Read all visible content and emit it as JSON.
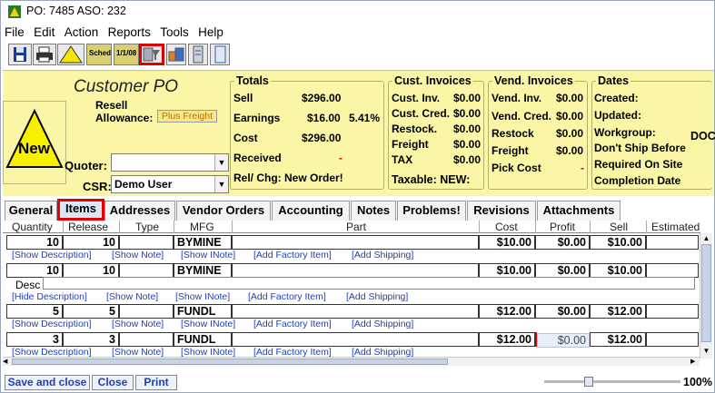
{
  "titlebar": {
    "title": "PO: 7485   ASO: 232"
  },
  "menu": [
    "File",
    "Edit",
    "Action",
    "Reports",
    "Tools",
    "Help"
  ],
  "toolbar": {
    "sched_label": "Sched",
    "date_label": "1/1/08"
  },
  "po": {
    "title": "Customer PO",
    "resell_label": "Resell",
    "allowance_label": "Allowance:",
    "plus_freight": "Plus Freight",
    "new_badge": "New",
    "quoter_label": "Quoter:",
    "quoter_value": "",
    "csr_label": "CSR:",
    "csr_value": "Demo User"
  },
  "totals": {
    "title": "Totals",
    "sell_label": "Sell",
    "sell": "$296.00",
    "earnings_label": "Earnings",
    "earnings": "$16.00",
    "earnings_pct": "5.41%",
    "cost_label": "Cost",
    "cost": "$296.00",
    "received_label": "Received",
    "received": "-",
    "relchg": "Rel/ Chg: New Order!"
  },
  "cust_invoices": {
    "title": "Cust. Invoices",
    "rows": [
      {
        "label": "Cust. Inv.",
        "value": "$0.00"
      },
      {
        "label": "Cust. Cred.",
        "value": "$0.00"
      },
      {
        "label": "Restock.",
        "value": "$0.00"
      },
      {
        "label": "Freight",
        "value": "$0.00"
      },
      {
        "label": "TAX",
        "value": "$0.00"
      }
    ],
    "taxable": "Taxable: NEW:"
  },
  "vend_invoices": {
    "title": "Vend. Invoices",
    "rows": [
      {
        "label": "Vend. Inv.",
        "value": "$0.00"
      },
      {
        "label": "Vend. Cred.",
        "value": "$0.00"
      },
      {
        "label": "Restock",
        "value": "$0.00"
      },
      {
        "label": "Freight",
        "value": "$0.00"
      }
    ],
    "pick_cost_label": "Pick Cost",
    "pick_cost": "-"
  },
  "dates": {
    "title": "Dates",
    "rows": [
      "Created:",
      "Updated:",
      "Workgroup:",
      "Don't Ship Before",
      "Required On Site",
      "Completion Date"
    ],
    "workgroup_value": "DOC"
  },
  "tabs": [
    "General",
    "Items",
    "Addresses",
    "Vendor Orders",
    "Accounting",
    "Notes",
    "Problems!",
    "Revisions",
    "Attachments"
  ],
  "grid": {
    "columns": [
      "Quantity",
      "Release",
      "Type",
      "MFG",
      "Part",
      "Cost",
      "Profit",
      "Sell",
      "Estimated"
    ],
    "rows": [
      {
        "qty": "10",
        "release": "10",
        "type": "",
        "mfg": "BYMINE",
        "part": "",
        "cost": "$10.00",
        "profit": "$0.00",
        "sell": "$10.00",
        "links": [
          "[Show Description]",
          "[Show Note]",
          "[Show INote]",
          "[Add Factory Item]",
          "[Add Shipping]"
        ]
      },
      {
        "qty": "10",
        "release": "10",
        "type": "",
        "mfg": "BYMINE",
        "part": "",
        "cost": "$10.00",
        "profit": "$0.00",
        "sell": "$10.00",
        "desc_label": "Desc",
        "links": [
          "[Hide Description]",
          "[Show Note]",
          "[Show INote]",
          "[Add Factory Item]",
          "[Add Shipping]"
        ]
      },
      {
        "qty": "5",
        "release": "5",
        "type": "",
        "mfg": "FUNDL",
        "part": "",
        "cost": "$12.00",
        "profit": "$0.00",
        "sell": "$12.00",
        "links": [
          "[Show Description]",
          "[Show Note]",
          "[Show INote]",
          "[Add Factory Item]",
          "[Add Shipping]"
        ]
      },
      {
        "qty": "3",
        "release": "3",
        "type": "",
        "mfg": "FUNDL",
        "part": "",
        "cost": "$12.00",
        "profit": "$0.00",
        "sell": "$12.00",
        "links": [
          "[Show Description]",
          "[Show Note]",
          "[Show INote]",
          "[Add Factory Item]",
          "[Add Shipping]"
        ]
      }
    ]
  },
  "footer": {
    "save_close": "Save and close",
    "close": "Close",
    "print": "Print",
    "zoom": "100%"
  },
  "colors": {
    "panel_bg": "#fbf6a6",
    "highlight": "#e00000",
    "link": "#1b3fbf"
  }
}
